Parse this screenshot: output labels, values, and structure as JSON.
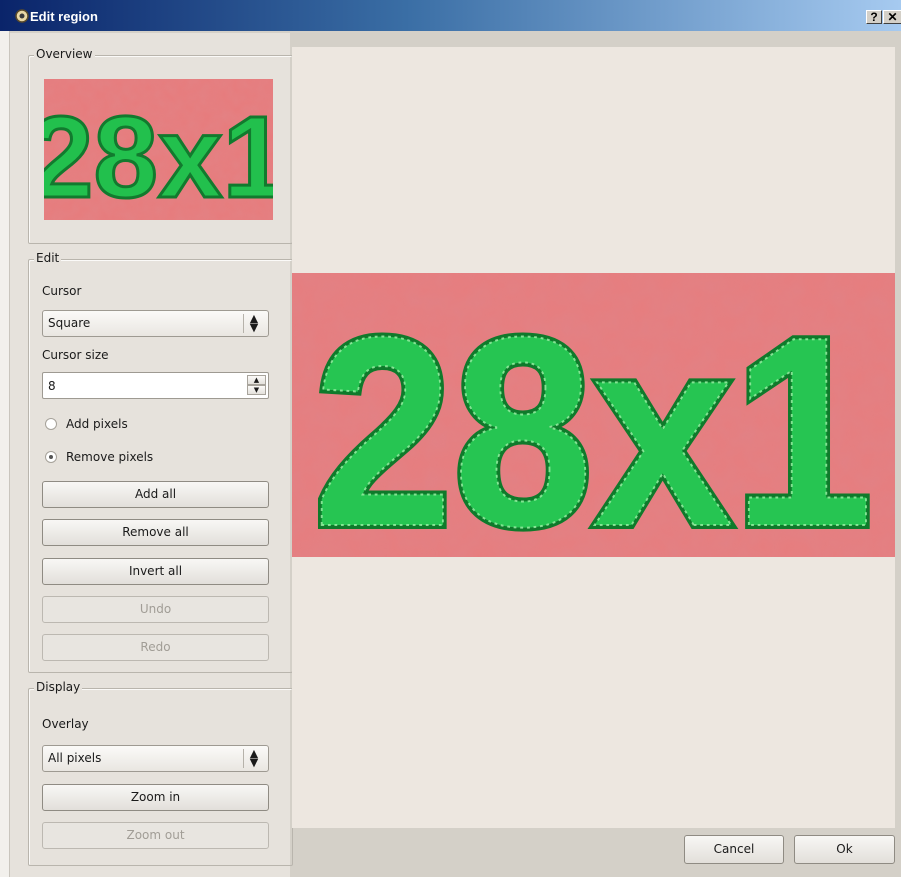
{
  "window": {
    "title": "Edit region",
    "help_label": "?",
    "close_label": "✕"
  },
  "overview": {
    "group_title": "Overview",
    "image_text": "28x1"
  },
  "edit": {
    "group_title": "Edit",
    "cursor_label": "Cursor",
    "cursor_value": "Square",
    "cursor_size_label": "Cursor size",
    "cursor_size_value": "8",
    "add_pixels_label": "Add pixels",
    "remove_pixels_label": "Remove pixels",
    "selected_mode": "Remove pixels",
    "add_all_label": "Add all",
    "remove_all_label": "Remove all",
    "invert_all_label": "Invert all",
    "undo_label": "Undo",
    "redo_label": "Redo"
  },
  "display": {
    "group_title": "Display",
    "overlay_label": "Overlay",
    "overlay_value": "All pixels",
    "zoom_in_label": "Zoom in",
    "zoom_out_label": "Zoom out"
  },
  "canvas": {
    "image_text": "28x1"
  },
  "dialog_buttons": {
    "cancel_label": "Cancel",
    "ok_label": "Ok"
  },
  "colors": {
    "background_region": "#e88080",
    "selected_pixels": "#1fc14a",
    "title_bar": "#0a246a"
  }
}
